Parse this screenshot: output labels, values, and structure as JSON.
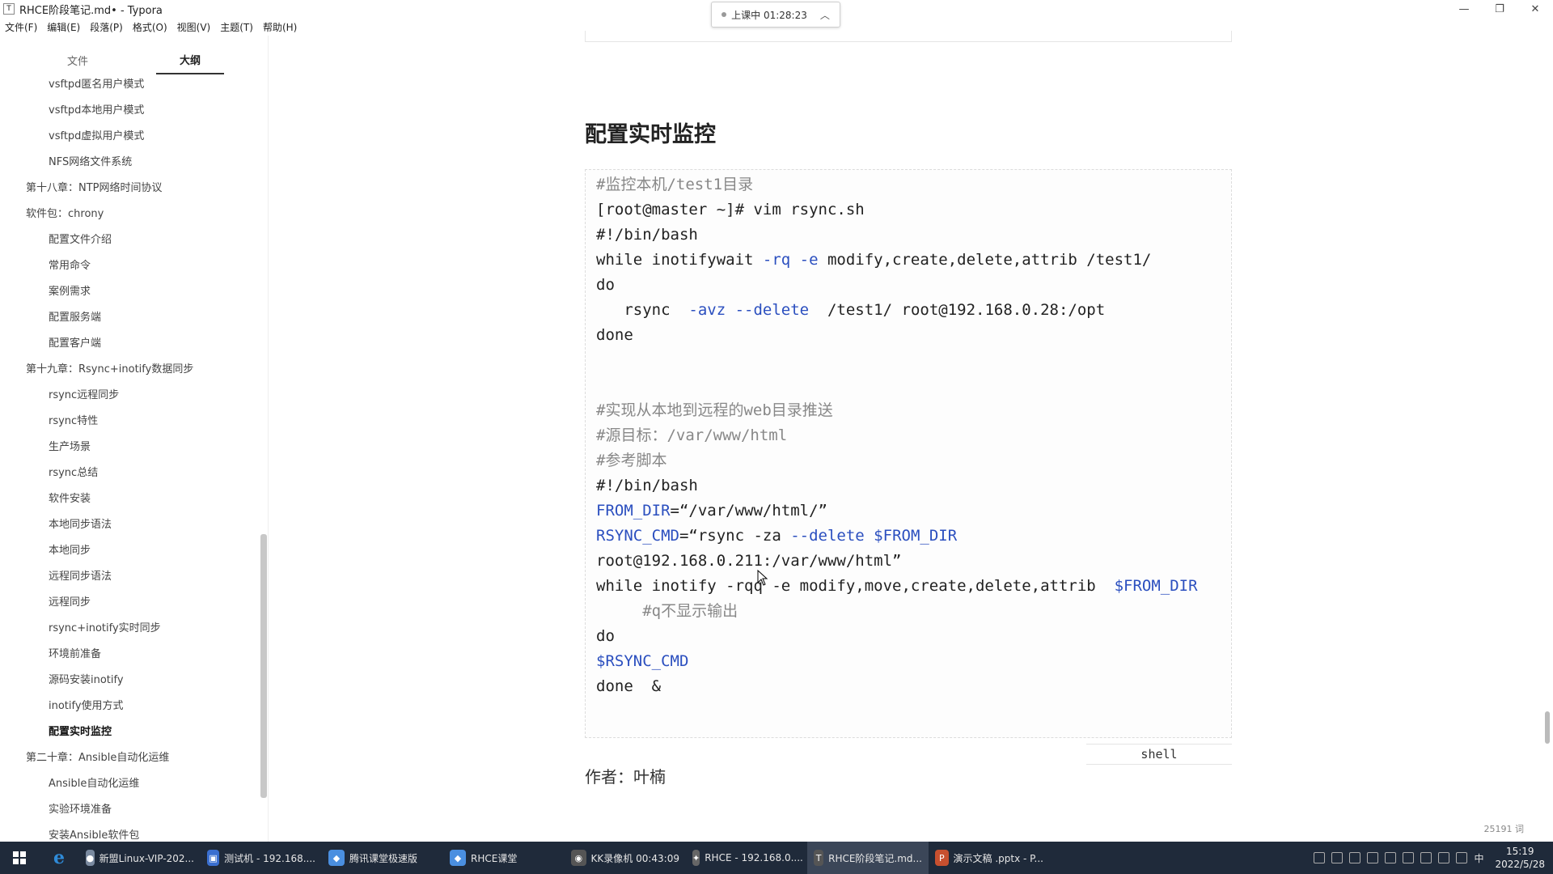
{
  "window": {
    "title": "RHCE阶段笔记.md• - Typora",
    "controls": {
      "minimize": "—",
      "maximize": "❐",
      "close": "✕"
    }
  },
  "timer": {
    "label": "上课中 01:28:23"
  },
  "menu": [
    "文件(F)",
    "编辑(E)",
    "段落(P)",
    "格式(O)",
    "视图(V)",
    "主题(T)",
    "帮助(H)"
  ],
  "sidebar": {
    "tabs": {
      "files": "文件",
      "outline": "大纲"
    },
    "items": [
      {
        "label": "vsftpd匿名用户模式",
        "level": 2
      },
      {
        "label": "vsftpd本地用户模式",
        "level": 2
      },
      {
        "label": "vsftpd虚拟用户模式",
        "level": 2
      },
      {
        "label": "NFS网络文件系统",
        "level": 2
      },
      {
        "label": "第十八章：NTP网络时间协议",
        "level": 1
      },
      {
        "label": "软件包：chrony",
        "level": 1
      },
      {
        "label": "配置文件介绍",
        "level": 2
      },
      {
        "label": "常用命令",
        "level": 2
      },
      {
        "label": "案例需求",
        "level": 2
      },
      {
        "label": "配置服务端",
        "level": 2
      },
      {
        "label": "配置客户端",
        "level": 2
      },
      {
        "label": "第十九章：Rsync+inotify数据同步",
        "level": 1
      },
      {
        "label": "rsync远程同步",
        "level": 2
      },
      {
        "label": "rsync特性",
        "level": 2
      },
      {
        "label": "生产场景",
        "level": 2
      },
      {
        "label": "rsync总结",
        "level": 2
      },
      {
        "label": "软件安装",
        "level": 2
      },
      {
        "label": "本地同步语法",
        "level": 2
      },
      {
        "label": "本地同步",
        "level": 2
      },
      {
        "label": "远程同步语法",
        "level": 2
      },
      {
        "label": "远程同步",
        "level": 2
      },
      {
        "label": "rsync+inotify实时同步",
        "level": 2
      },
      {
        "label": "环境前准备",
        "level": 2
      },
      {
        "label": "源码安装inotify",
        "level": 2
      },
      {
        "label": "inotify使用方式",
        "level": 2
      },
      {
        "label": "配置实时监控",
        "level": 2,
        "active": true
      },
      {
        "label": "第二十章：Ansible自动化运维",
        "level": 1
      },
      {
        "label": "Ansible自动化运维",
        "level": 2
      },
      {
        "label": "实验环境准备",
        "level": 2
      },
      {
        "label": "安装Ansible软件包",
        "level": 2
      }
    ],
    "bottom": {
      "back": "‹",
      "source": "</>"
    }
  },
  "editor": {
    "heading": "配置实时监控",
    "code_lines": [
      [
        {
          "t": "#监控本机/test1目录",
          "c": "cm"
        }
      ],
      [
        {
          "t": "[root@master ~]# vim rsync.sh",
          "c": ""
        }
      ],
      [
        {
          "t": "#!/bin/bash",
          "c": ""
        }
      ],
      [
        {
          "t": "while inotifywait ",
          "c": ""
        },
        {
          "t": "-rq -e",
          "c": "kw"
        },
        {
          "t": " modify,create,delete,attrib /test1/",
          "c": ""
        }
      ],
      [
        {
          "t": "do",
          "c": ""
        }
      ],
      [
        {
          "t": "   rsync  ",
          "c": ""
        },
        {
          "t": "-avz --delete",
          "c": "kw"
        },
        {
          "t": "  /test1/ root@192.168.0.28:/opt",
          "c": ""
        }
      ],
      [
        {
          "t": "done",
          "c": ""
        }
      ],
      [
        {
          "t": "",
          "c": ""
        }
      ],
      [
        {
          "t": "",
          "c": ""
        }
      ],
      [
        {
          "t": "#实现从本地到远程的web目录推送",
          "c": "cm"
        }
      ],
      [
        {
          "t": "#源目标：/var/www/html",
          "c": "cm"
        }
      ],
      [
        {
          "t": "#参考脚本",
          "c": "cm"
        }
      ],
      [
        {
          "t": "#!/bin/bash",
          "c": ""
        }
      ],
      [
        {
          "t": "FROM_DIR",
          "c": "kw"
        },
        {
          "t": "=“/var/www/html/”",
          "c": ""
        }
      ],
      [
        {
          "t": "RSYNC_CMD",
          "c": "kw"
        },
        {
          "t": "=“rsync -za ",
          "c": ""
        },
        {
          "t": "--delete $FROM_DIR",
          "c": "kw"
        }
      ],
      [
        {
          "t": "root@192.168.0.211:/var/www/html”",
          "c": ""
        }
      ],
      [
        {
          "t": "while inotify -rqq -e modify,move,create,delete,attrib  ",
          "c": ""
        },
        {
          "t": "$FROM_DIR",
          "c": "kw"
        }
      ],
      [
        {
          "t": "     #q不显示输出",
          "c": "cm"
        }
      ],
      [
        {
          "t": "do",
          "c": ""
        }
      ],
      [
        {
          "t": "$RSYNC_CMD",
          "c": "kw"
        }
      ],
      [
        {
          "t": "done  &",
          "c": ""
        }
      ]
    ],
    "code_language": "shell",
    "author": "作者：叶楠",
    "word_count": "25191 词"
  },
  "taskbar": {
    "items": [
      {
        "label": "新盟Linux-VIP-202...",
        "color": "#7a8aa0",
        "icon": "●"
      },
      {
        "label": "测试机 - 192.168....",
        "color": "#3a6fd0",
        "icon": "▣"
      },
      {
        "label": "腾讯课堂极速版",
        "color": "#4a8fe0",
        "icon": "◆"
      },
      {
        "label": "RHCE课堂",
        "color": "#4a8fe0",
        "icon": "◆"
      },
      {
        "label": "KK录像机 00:43:09",
        "color": "#555",
        "icon": "◉"
      },
      {
        "label": "RHCE - 192.168.0....",
        "color": "#666",
        "icon": "✦"
      },
      {
        "label": "RHCE阶段笔记.md...",
        "color": "#555",
        "icon": "T",
        "active": true
      },
      {
        "label": "演示文稿 .pptx - P...",
        "color": "#c8502f",
        "icon": "P"
      }
    ],
    "clock": {
      "time": "15:19",
      "date": "2022/5/28"
    },
    "ime": "中"
  }
}
